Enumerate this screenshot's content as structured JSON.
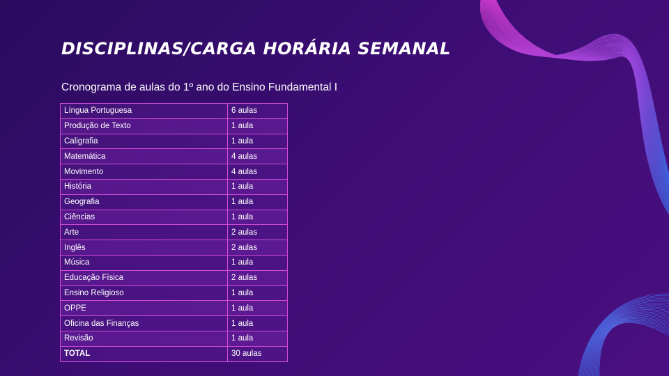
{
  "slide": {
    "title": "DISCIPLINAS/CARGA HORÁRIA SEMANAL",
    "subtitle": "Cronograma de aulas do 1º ano do Ensino Fundamental I"
  },
  "schedule": {
    "rows": [
      {
        "subject": "Língua Portuguesa",
        "hours": "6 aulas"
      },
      {
        "subject": "Produção de Texto",
        "hours": "1 aula"
      },
      {
        "subject": "Caligrafia",
        "hours": "1 aula"
      },
      {
        "subject": "Matemática",
        "hours": "4 aulas"
      },
      {
        "subject": "Movimento",
        "hours": "4 aulas"
      },
      {
        "subject": "História",
        "hours": "1 aula"
      },
      {
        "subject": "Geografia",
        "hours": "1 aula"
      },
      {
        "subject": "Ciências",
        "hours": "1 aula"
      },
      {
        "subject": "Arte",
        "hours": "2 aulas"
      },
      {
        "subject": "Inglês",
        "hours": "2 aulas"
      },
      {
        "subject": "Música",
        "hours": "1 aula"
      },
      {
        "subject": "Educação Física",
        "hours": "2 aulas"
      },
      {
        "subject": "Ensino Religioso",
        "hours": "1 aula"
      },
      {
        "subject": "OPPE",
        "hours": "1 aula"
      },
      {
        "subject": "Oficina das Finanças",
        "hours": "1 aula"
      },
      {
        "subject": "Revisão",
        "hours": "1 aula"
      }
    ],
    "total": {
      "subject": "TOTAL",
      "hours": "30 aulas"
    }
  },
  "colors": {
    "background": "#3c0d74",
    "table_border": "#d44bd8",
    "wave_pink": "#e040d8",
    "wave_blue": "#3a6ee8"
  }
}
